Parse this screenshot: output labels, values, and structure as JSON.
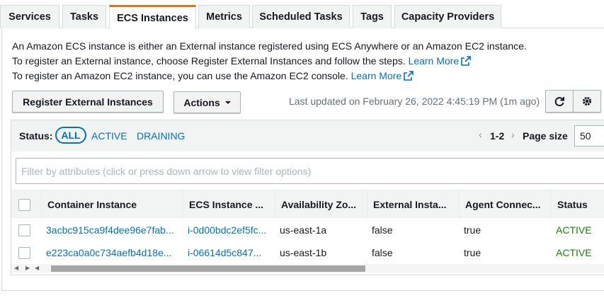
{
  "tabs": [
    {
      "label": "Services"
    },
    {
      "label": "Tasks"
    },
    {
      "label": "ECS Instances"
    },
    {
      "label": "Metrics"
    },
    {
      "label": "Scheduled Tasks"
    },
    {
      "label": "Tags"
    },
    {
      "label": "Capacity Providers"
    }
  ],
  "active_tab": "ECS Instances",
  "description": {
    "line1": "An Amazon ECS instance is either an External instance registered using ECS Anywhere or an Amazon EC2 instance.",
    "line2": "To register an External instance, choose Register External Instances and follow the steps.",
    "line3": "To register an Amazon EC2 instance, you can use the Amazon EC2 console.",
    "learn_more": "Learn More"
  },
  "actions": {
    "register_label": "Register External Instances",
    "actions_label": "Actions",
    "last_updated": "Last updated on February 26, 2022 4:45:19 PM (1m ago)"
  },
  "filter_status": {
    "label": "Status:",
    "options": [
      "ALL",
      "ACTIVE",
      "DRAINING"
    ],
    "selected": "ALL"
  },
  "pagination": {
    "range": "1-2",
    "page_size_label": "Page size",
    "page_size": "50"
  },
  "filter_placeholder": "Filter by attributes (click or press down arrow to view filter options)",
  "table": {
    "columns": [
      "Container Instance",
      "ECS Instance ...",
      "Availability Zo...",
      "External Insta...",
      "Agent Connec...",
      "Status"
    ],
    "rows": [
      {
        "container_instance": "3acbc915ca9f4dee96e7fab...",
        "ecs_instance": "i-0d00bdc2ef5fc...",
        "az": "us-east-1a",
        "external": "false",
        "agent": "true",
        "status": "ACTIVE"
      },
      {
        "container_instance": "e223ca0a0c734aefb4d18e...",
        "ecs_instance": "i-06614d5c847...",
        "az": "us-east-1b",
        "external": "false",
        "agent": "true",
        "status": "ACTIVE"
      }
    ]
  },
  "icons": {
    "external_link": "external-link-icon",
    "refresh": "refresh-icon",
    "settings": "gear-icon"
  },
  "colors": {
    "link": "#0073bb",
    "active_tab_accent": "#ec7211",
    "status_active": "#1d8102"
  }
}
